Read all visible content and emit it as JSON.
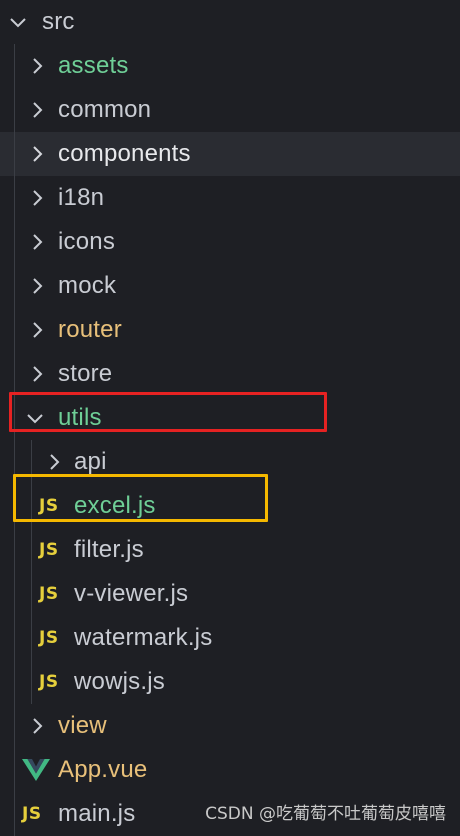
{
  "root": {
    "label": "src",
    "expanded": true
  },
  "folders": {
    "assets": "assets",
    "common": "common",
    "components": "components",
    "i18n": "i18n",
    "icons": "icons",
    "mock": "mock",
    "router": "router",
    "store": "store",
    "utils": "utils",
    "api": "api",
    "view": "view"
  },
  "utils_files": [
    "excel.js",
    "filter.js",
    "v-viewer.js",
    "watermark.js",
    "wowjs.js"
  ],
  "root_files": {
    "app_vue": "App.vue",
    "main_js": "main.js"
  },
  "file_badge": "JS",
  "watermark": "CSDN @吃葡萄不吐葡萄皮嘻嘻",
  "colors": {
    "background": "#1e1f24",
    "git_added": "#6fcf97",
    "git_modified": "#e8c07a",
    "default_text": "#c9ccd3",
    "js_badge": "#e6cf3c",
    "vue_green": "#41b883",
    "annotation_red": "#e62222",
    "annotation_yellow": "#f5b800"
  },
  "icons": {
    "collapsed": "chevron-right-icon",
    "expanded": "chevron-down-icon",
    "js": "js-file-icon",
    "vue": "vue-file-icon"
  }
}
